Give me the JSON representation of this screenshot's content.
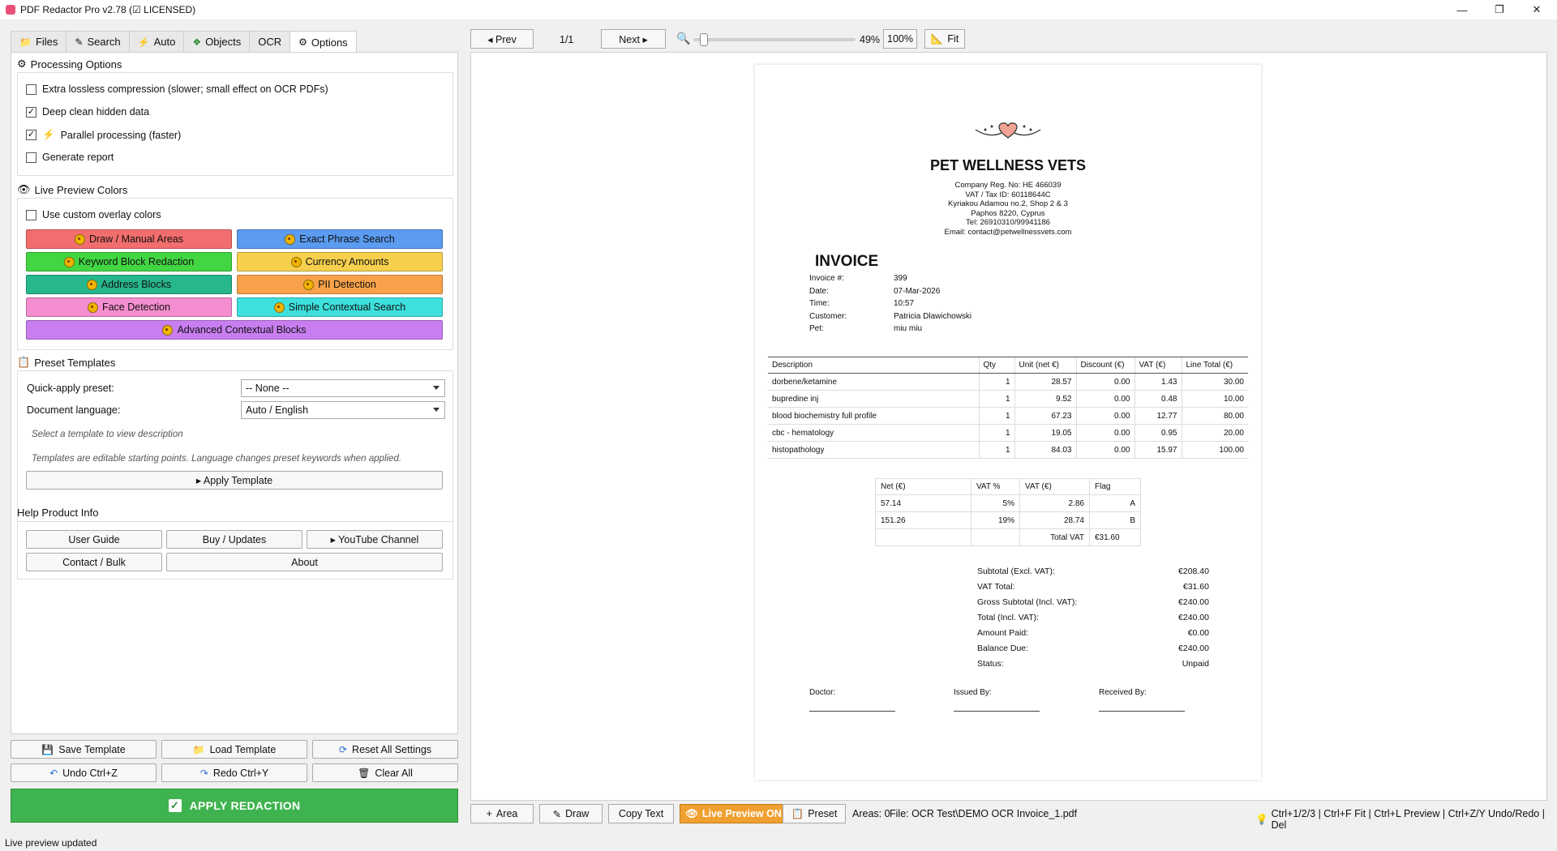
{
  "window": {
    "title": "PDF Redactor Pro v2.78 (☑ LICENSED)",
    "controls": [
      "—",
      "❐",
      "✕"
    ]
  },
  "tabs": [
    {
      "label": "Files",
      "icon": "folder-icon"
    },
    {
      "label": "Search",
      "icon": "pencil-icon"
    },
    {
      "label": "Auto",
      "icon": "lightning-icon"
    },
    {
      "label": "Objects",
      "icon": "puzzle-icon"
    },
    {
      "label": "OCR",
      "icon": ""
    },
    {
      "label": "Options",
      "icon": "gear-icon"
    }
  ],
  "processing": {
    "title": "Processing Options",
    "options": [
      {
        "label": "Extra lossless compression (slower; small effect on OCR PDFs)",
        "checked": false
      },
      {
        "label": "Deep clean hidden data",
        "checked": true
      },
      {
        "label": "Parallel processing (faster)",
        "checked": true
      },
      {
        "label": "Generate report",
        "checked": false
      }
    ]
  },
  "preview_colors": {
    "title": "Live Preview Colors",
    "custom_label": "Use custom overlay colors",
    "buttons": [
      {
        "label": "Draw / Manual Areas",
        "color": "#f26d6d"
      },
      {
        "label": "Exact Phrase Search",
        "color": "#5b9bf0"
      },
      {
        "label": "Keyword Block Redaction",
        "color": "#42d642"
      },
      {
        "label": "Currency Amounts",
        "color": "#f6d04d"
      },
      {
        "label": "Address Blocks",
        "color": "#27b78c"
      },
      {
        "label": "PII Detection",
        "color": "#f8a14a"
      },
      {
        "label": "Face Detection",
        "color": "#f58ed0"
      },
      {
        "label": "Simple Contextual Search",
        "color": "#3de0dc"
      },
      {
        "label": "Advanced Contextual Blocks",
        "color": "#c87ef0"
      }
    ]
  },
  "templates": {
    "title": "Preset Templates",
    "quick_label": "Quick-apply preset:",
    "quick_value": "-- None --",
    "lang_label": "Document language:",
    "lang_value": "Auto / English",
    "hint1": "Select a template to view description",
    "hint2": "Templates are editable starting points. Language changes preset keywords when applied.",
    "apply_label": "▸ Apply Template"
  },
  "help": {
    "title": "Help  Product Info",
    "buttons": [
      "User Guide",
      "Buy / Updates",
      "▸ YouTube Channel",
      "Contact / Bulk",
      "About"
    ]
  },
  "bottom_actions": {
    "save": "Save Template",
    "load": "Load Template",
    "reset": "Reset All Settings",
    "undo": "Undo  Ctrl+Z",
    "redo": "Redo  Ctrl+Y",
    "clear": "Clear All",
    "apply": "APPLY REDACTION"
  },
  "status": "Live preview updated",
  "viewer_toolbar": {
    "prev": "◂ Prev",
    "page": "1/1",
    "next": "Next ▸",
    "zoom_level": 0.49,
    "zoom": "49%",
    "zoom100": "100%",
    "fit": "Fit"
  },
  "viewer_bottom": {
    "area": "Area",
    "draw": "Draw",
    "copy": "Copy Text",
    "live": "Live Preview ON",
    "preset": "Preset",
    "areas": "Areas: 0",
    "file": "File: OCR Test\\DEMO OCR Invoice_1.pdf",
    "shortcuts": "Ctrl+1/2/3 | Ctrl+F Fit | Ctrl+L Preview | Ctrl+Z/Y Undo/Redo | Del"
  },
  "invoice": {
    "company": "PET WELLNESS VETS",
    "reg": "Company Reg. No: HE 466039",
    "vat_id": "VAT / Tax ID: 60118644C",
    "addr1": "Kyriakou Adamou no.2, Shop 2 & 3",
    "addr2": "Paphos 8220, Cyprus",
    "tel": "Tel: 26910310/99941186",
    "email": "Email: contact@petwellnessvets.com",
    "heading": "INVOICE",
    "meta": [
      {
        "k": "Invoice #:",
        "v": "399"
      },
      {
        "k": "Date:",
        "v": "07-Mar-2026"
      },
      {
        "k": "Time:",
        "v": "10:57"
      },
      {
        "k": "Customer:",
        "v": "Patricia Dlawichowski"
      },
      {
        "k": "Pet:",
        "v": "miu miu"
      }
    ],
    "item_headers": [
      "Description",
      "Qty",
      "Unit (net €)",
      "Discount (€)",
      "VAT (€)",
      "Line Total (€)"
    ],
    "items": [
      [
        "dorbene/ketamine",
        "1",
        "28.57",
        "0.00",
        "1.43",
        "30.00"
      ],
      [
        "bupredine inj",
        "1",
        "9.52",
        "0.00",
        "0.48",
        "10.00"
      ],
      [
        "blood biochemistry full profile",
        "1",
        "67.23",
        "0.00",
        "12.77",
        "80.00"
      ],
      [
        "cbc - hematology",
        "1",
        "19.05",
        "0.00",
        "0.95",
        "20.00"
      ],
      [
        "histopathology",
        "1",
        "84.03",
        "0.00",
        "15.97",
        "100.00"
      ]
    ],
    "vat_headers": [
      "Net (€)",
      "VAT %",
      "VAT (€)",
      "Flag"
    ],
    "vat_rows": [
      [
        "57.14",
        "5%",
        "2.86",
        "A"
      ],
      [
        "151.26",
        "19%",
        "28.74",
        "B"
      ],
      [
        "",
        "",
        "Total VAT",
        "€31.60"
      ]
    ],
    "totals": [
      {
        "k": "Subtotal (Excl. VAT):",
        "v": "€208.40"
      },
      {
        "k": "VAT Total:",
        "v": "€31.60"
      },
      {
        "k": "Gross Subtotal (Incl. VAT):",
        "v": "€240.00"
      },
      {
        "k": "Total (Incl. VAT):",
        "v": "€240.00"
      },
      {
        "k": "Amount Paid:",
        "v": "€0.00"
      },
      {
        "k": "Balance Due:",
        "v": "€240.00"
      },
      {
        "k": "Status:",
        "v": "Unpaid"
      }
    ],
    "sign": [
      "Doctor:",
      "Issued By:",
      "Received By:"
    ]
  }
}
